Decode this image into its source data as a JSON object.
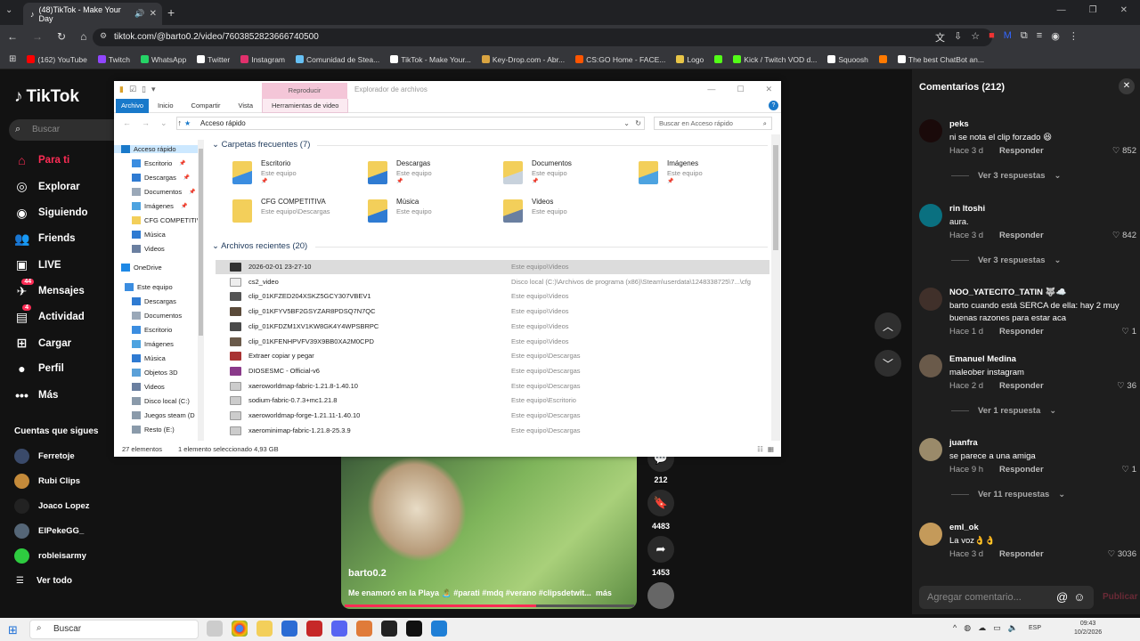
{
  "browser": {
    "tab_title": "(48)TikTok - Make Your Day",
    "url": "tiktok.com/@barto0.2/video/7603852823666740500",
    "bookmarks": [
      {
        "label": "(162) YouTube",
        "color": "#ff0000"
      },
      {
        "label": "Twitch",
        "color": "#9146ff"
      },
      {
        "label": "WhatsApp",
        "color": "#25d366"
      },
      {
        "label": "Twitter",
        "color": "#ffffff"
      },
      {
        "label": "Instagram",
        "color": "#e1306c"
      },
      {
        "label": "Comunidad de Stea...",
        "color": "#66c0f4"
      },
      {
        "label": "TikTok - Make Your...",
        "color": "#ffffff"
      },
      {
        "label": "Key-Drop.com - Abr...",
        "color": "#d9a441"
      },
      {
        "label": "CS:GO Home - FACE...",
        "color": "#ff5500"
      },
      {
        "label": "Logo",
        "color": "#e8c547"
      },
      {
        "label": "",
        "color": "#53fc18"
      },
      {
        "label": "Kick / Twitch VOD d...",
        "color": "#53fc18"
      },
      {
        "label": "Squoosh",
        "color": "#ffffff"
      },
      {
        "label": "",
        "color": "#ff7a00"
      },
      {
        "label": "The best ChatBot an...",
        "color": "#ffffff"
      }
    ]
  },
  "tiktok": {
    "logo": "TikTok",
    "search_placeholder": "Buscar",
    "nav": [
      {
        "label": "Para ti",
        "icon": "home-icon",
        "active": true
      },
      {
        "label": "Explorar",
        "icon": "compass-icon"
      },
      {
        "label": "Siguiendo",
        "icon": "following-icon"
      },
      {
        "label": "Friends",
        "icon": "friends-icon"
      },
      {
        "label": "LIVE",
        "icon": "live-icon"
      },
      {
        "label": "Mensajes",
        "icon": "messages-icon",
        "badge": "44"
      },
      {
        "label": "Actividad",
        "icon": "activity-icon",
        "badge": "4"
      },
      {
        "label": "Cargar",
        "icon": "upload-icon"
      },
      {
        "label": "Perfil",
        "icon": "profile-icon"
      },
      {
        "label": "Más",
        "icon": "more-icon"
      }
    ],
    "following_title": "Cuentas que sigues",
    "following": [
      "Ferretoje",
      "Rubi Clips",
      "Joaco Lopez",
      "ElPekeGG_",
      "robleisarmy"
    ],
    "see_all": "Ver todo",
    "video": {
      "user": "barto0.2",
      "description": "Me enamoró en la Playa 🏝️ #parati #mdq #verano #clipsdetwit...",
      "more": "más",
      "progress": 0.66
    },
    "actions": {
      "comments": "212",
      "saves": "4483",
      "shares": "1453"
    }
  },
  "comments": {
    "title": "Comentarios",
    "count": "(212)",
    "items": [
      {
        "user": "peks",
        "text": "ni se nota el clip forzado 😆",
        "time": "Hace 3 d",
        "reply": "Responder",
        "likes": "852",
        "replies": "Ver 3 respuestas"
      },
      {
        "user": "rin ltoshi",
        "text": "aura.",
        "time": "Hace 3 d",
        "reply": "Responder",
        "likes": "842",
        "replies": "Ver 3 respuestas"
      },
      {
        "user": "NOO_YATECITO_TATIN 🐺☁️",
        "text": "barto cuando está SERCA de ella: hay 2 muy buenas razones para estar aca",
        "time": "Hace 1 d",
        "reply": "Responder",
        "likes": "1",
        "replies": ""
      },
      {
        "user": "Emanuel Medina",
        "text": "maleober instagram",
        "time": "Hace 2 d",
        "reply": "Responder",
        "likes": "36",
        "replies": "Ver 1 respuesta"
      },
      {
        "user": "juanfra",
        "text": "se parece a una amiga",
        "time": "Hace 9 h",
        "reply": "Responder",
        "likes": "1",
        "replies": "Ver 11 respuestas"
      },
      {
        "user": "eml_ok",
        "text": "La voz👌👌",
        "time": "Hace 3 d",
        "reply": "Responder",
        "likes": "3036",
        "replies": ""
      }
    ],
    "input_placeholder": "Agregar comentario...",
    "post": "Publicar"
  },
  "explorer": {
    "play_tab": "Reproducir",
    "title": "Explorador de archivos",
    "ribbon": [
      "Archivo",
      "Inicio",
      "Compartir",
      "Vista",
      "Herramientas de video"
    ],
    "path": "Acceso rápido",
    "search_placeholder": "Buscar en Acceso rápido",
    "nav": [
      {
        "label": "Acceso rápido",
        "color": "#1979ca",
        "sel": true
      },
      {
        "label": "Escritorio",
        "color": "#3b8de0",
        "pin": true
      },
      {
        "label": "Descargas",
        "color": "#2f7bd2",
        "pin": true
      },
      {
        "label": "Documentos",
        "color": "#9aa8b8",
        "pin": true
      },
      {
        "label": "Imágenes",
        "color": "#4da3e0",
        "pin": true
      },
      {
        "label": "CFG COMPETITIV",
        "color": "#f3cf5a"
      },
      {
        "label": "Música",
        "color": "#2f7bd2"
      },
      {
        "label": "Videos",
        "color": "#6a7fa0"
      },
      {
        "label": "OneDrive",
        "color": "#1e88e5"
      },
      {
        "label": "Este equipo",
        "color": "#3b8de0"
      },
      {
        "label": "Descargas",
        "color": "#2f7bd2"
      },
      {
        "label": "Documentos",
        "color": "#9aa8b8"
      },
      {
        "label": "Escritorio",
        "color": "#3b8de0"
      },
      {
        "label": "Imágenes",
        "color": "#4da3e0"
      },
      {
        "label": "Música",
        "color": "#2f7bd2"
      },
      {
        "label": "Objetos 3D",
        "color": "#5aa0d8"
      },
      {
        "label": "Videos",
        "color": "#6a7fa0"
      },
      {
        "label": "Disco local (C:)",
        "color": "#8a9aaa"
      },
      {
        "label": "Juegos steam (D",
        "color": "#8a9aaa"
      },
      {
        "label": "Resto (E:)",
        "color": "#8a9aaa"
      }
    ],
    "frequent_title": "Carpetas frecuentes (7)",
    "frequent": [
      {
        "name": "Escritorio",
        "sub": "Este equipo"
      },
      {
        "name": "Descargas",
        "sub": "Este equipo"
      },
      {
        "name": "Documentos",
        "sub": "Este equipo"
      },
      {
        "name": "Imágenes",
        "sub": "Este equipo"
      },
      {
        "name": "CFG COMPETITIVA",
        "sub": "Este equipo\\Descargas"
      },
      {
        "name": "Música",
        "sub": "Este equipo"
      },
      {
        "name": "Videos",
        "sub": "Este equipo"
      }
    ],
    "recent_title": "Archivos recientes (20)",
    "recent": [
      {
        "name": "2026-02-01 23-27-10",
        "path": "Este equipo\\Videos"
      },
      {
        "name": "cs2_video",
        "path": "Disco local (C:)\\Archivos de programa (x86)\\Steam\\userdata\\1248338725\\7...\\cfg"
      },
      {
        "name": "clip_01KFZED204XSKZ5GCY307VBEV1",
        "path": "Este equipo\\Videos"
      },
      {
        "name": "clip_01KFYV5BF2GSYZAR8PDSQ7N7QC",
        "path": "Este equipo\\Videos"
      },
      {
        "name": "clip_01KFDZM1XV1KW8GK4Y4WPSBRPC",
        "path": "Este equipo\\Videos"
      },
      {
        "name": "clip_01KFENHPVFV39X9BB0XA2M0CPD",
        "path": "Este equipo\\Videos"
      },
      {
        "name": "Extraer copiar y pegar",
        "path": "Este equipo\\Descargas"
      },
      {
        "name": "DIOSESMC - Official-v6",
        "path": "Este equipo\\Descargas"
      },
      {
        "name": "xaeroworldmap-fabric-1.21.8-1.40.10",
        "path": "Este equipo\\Descargas"
      },
      {
        "name": "sodium-fabric-0.7.3+mc1.21.8",
        "path": "Este equipo\\Escritorio"
      },
      {
        "name": "xaeroworldmap-forge-1.21.11-1.40.10",
        "path": "Este equipo\\Descargas"
      },
      {
        "name": "xaerominimap-fabric-1.21.8-25.3.9",
        "path": "Este equipo\\Descargas"
      }
    ],
    "status_items": "27 elementos",
    "status_selected": "1 elemento seleccionado  4,93 GB"
  },
  "taskbar": {
    "search": "Buscar",
    "lang": "ESP",
    "time": "09:43",
    "date": "10/2/2026"
  }
}
